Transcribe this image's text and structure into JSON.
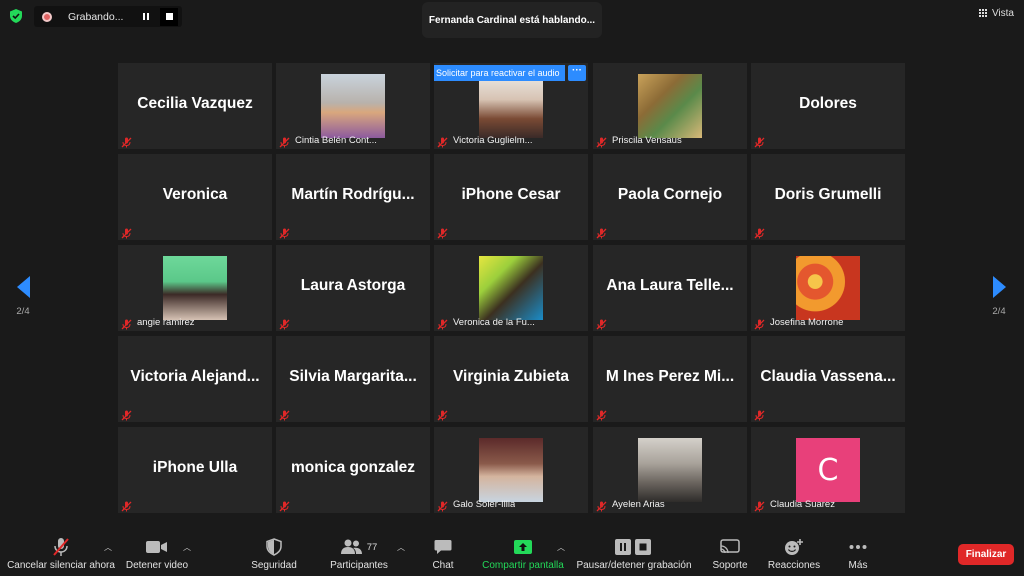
{
  "topbar": {
    "recording_label": "Grabando...",
    "speaking_notice": "Fernanda Cardinal está hablando...",
    "view_label": "Vista"
  },
  "pager": {
    "left_label": "2/4",
    "right_label": "2/4"
  },
  "unmute_banner": {
    "label": "Solicitar para reactivar el audio",
    "more_label": "···"
  },
  "tiles": [
    {
      "name": "Cecilia Vazquez",
      "label": "",
      "photo": false
    },
    {
      "name": "",
      "label": "Cintia Belén Cont...",
      "photo": true
    },
    {
      "name": "",
      "label": "Victoria Guglielm...",
      "photo": true
    },
    {
      "name": "",
      "label": "Priscila Vensaus",
      "photo": true
    },
    {
      "name": "Dolores",
      "label": "",
      "photo": false
    },
    {
      "name": "Veronica",
      "label": "",
      "photo": false
    },
    {
      "name": "Martín  Rodrígu...",
      "label": "",
      "photo": false
    },
    {
      "name": "iPhone Cesar",
      "label": "",
      "photo": false
    },
    {
      "name": "Paola Cornejo",
      "label": "",
      "photo": false
    },
    {
      "name": "Doris Grumelli",
      "label": "",
      "photo": false
    },
    {
      "name": "",
      "label": "angie ramirez",
      "photo": true
    },
    {
      "name": "Laura Astorga",
      "label": "",
      "photo": false
    },
    {
      "name": "",
      "label": "Veronica de la Fu...",
      "photo": true
    },
    {
      "name": "Ana  Laura  Telle...",
      "label": "",
      "photo": false
    },
    {
      "name": "",
      "label": "Josefina Morrone",
      "photo": true
    },
    {
      "name": "Victoria  Alejand...",
      "label": "",
      "photo": false
    },
    {
      "name": "Silvia  Margarita...",
      "label": "",
      "photo": false
    },
    {
      "name": "Virginia Zubieta",
      "label": "",
      "photo": false
    },
    {
      "name": "M  Ines  Perez  Mi...",
      "label": "",
      "photo": false
    },
    {
      "name": "Claudia  Vassena...",
      "label": "",
      "photo": false
    },
    {
      "name": "iPhone Ulla",
      "label": "",
      "photo": false
    },
    {
      "name": "monica gonzalez",
      "label": "",
      "photo": false
    },
    {
      "name": "",
      "label": "Galo Soler-Illia",
      "photo": true
    },
    {
      "name": "",
      "label": "Ayelen Arias",
      "photo": true
    },
    {
      "name": "",
      "label": "Claudia Suarez",
      "photo": false,
      "avatar_letter": "C"
    }
  ],
  "toolbar": {
    "unmute": "Cancelar silenciar ahora",
    "video": "Detener video",
    "security": "Seguridad",
    "participants": "Participantes",
    "participants_count": "77",
    "chat": "Chat",
    "share": "Compartir pantalla",
    "record": "Pausar/detener grabación",
    "support": "Soporte",
    "reactions": "Reacciones",
    "more": "Más",
    "end": "Finalizar"
  },
  "colors": {
    "accent": "#2d8cff",
    "share_green": "#23d959",
    "end_red": "#e02828",
    "avatar_pink": "#e8407a",
    "muted_red": "#e02828"
  }
}
